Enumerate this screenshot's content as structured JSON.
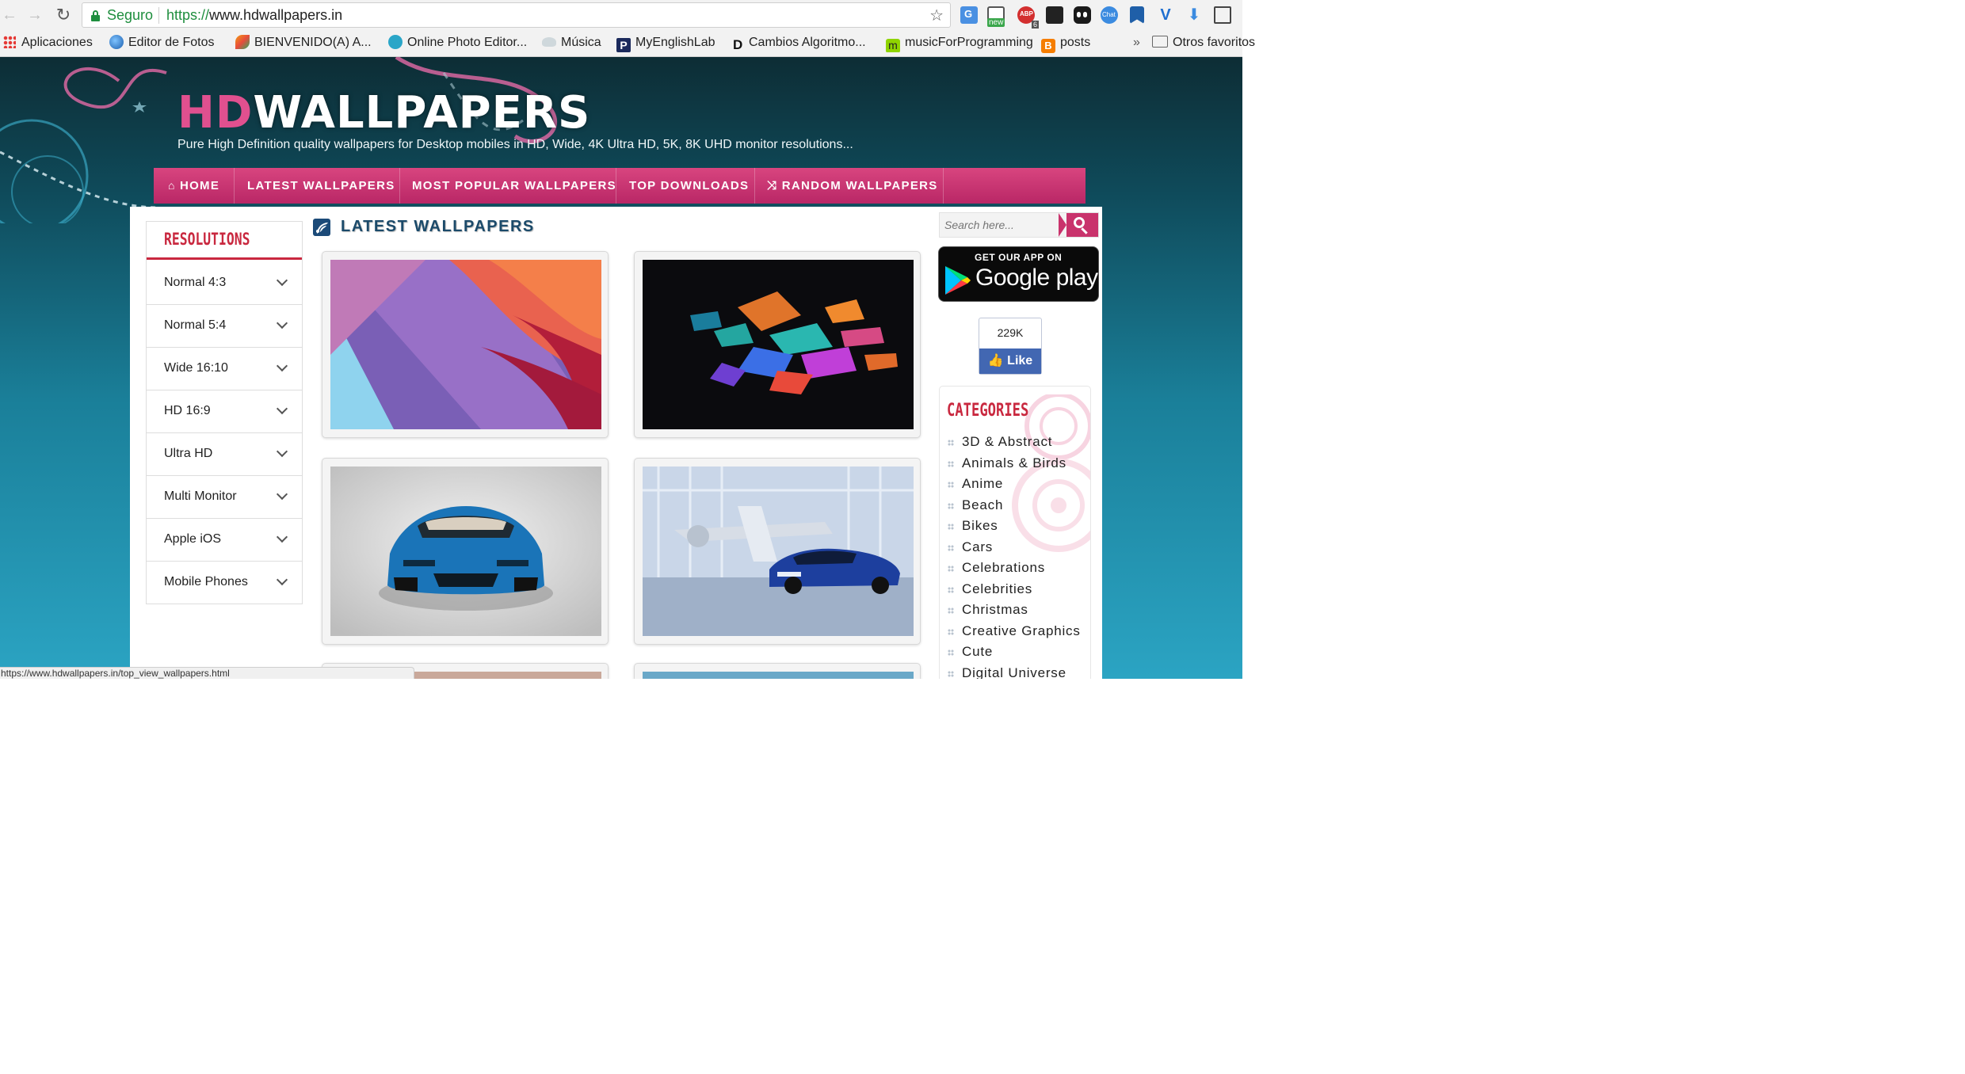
{
  "browser": {
    "secure_label": "Seguro",
    "url_scheme": "https://",
    "url_host": "www.hdwallpapers.in",
    "extensions": [
      "translate-icon",
      "new-icon",
      "adblock-icon",
      "clapper-icon",
      "eyes-icon",
      "chat-icon",
      "bookmark-icon",
      "vector-icon",
      "download-icon",
      "screen-icon"
    ],
    "extension_badges": {
      "new": "new",
      "adblock": "6",
      "chat": "Chat"
    }
  },
  "bookmarks": {
    "items": [
      {
        "label": "Aplicaciones",
        "icon": "apps-grid-icon"
      },
      {
        "label": "Editor de Fotos",
        "icon": "globe-icon"
      },
      {
        "label": "BIENVENIDO(A) A...",
        "icon": "leaf-icon"
      },
      {
        "label": "Online Photo Editor...",
        "icon": "swirl-icon"
      },
      {
        "label": "Música",
        "icon": "cloud-icon"
      },
      {
        "label": "MyEnglishLab",
        "icon": "p-icon"
      },
      {
        "label": "Cambios Algoritmo...",
        "icon": "d-icon"
      },
      {
        "label": "musicForProgramming",
        "icon": "m-icon"
      },
      {
        "label": "posts",
        "icon": "blogger-icon"
      }
    ],
    "overflow": "»",
    "other": "Otros favoritos"
  },
  "site": {
    "logo_hd": "HD",
    "logo_wallpapers": "WALLPAPERS",
    "tagline": "Pure High Definition quality wallpapers for Desktop mobiles in HD, Wide, 4K Ultra HD, 5K, 8K UHD monitor resolutions...",
    "nav": [
      "HOME",
      "LATEST WALLPAPERS",
      "MOST POPULAR WALLPAPERS",
      "TOP DOWNLOADS",
      "RANDOM WALLPAPERS"
    ],
    "accent": "#c9336c"
  },
  "sidebar": {
    "title": "RESOLUTIONS",
    "items": [
      "Normal 4:3",
      "Normal 5:4",
      "Wide 16:10",
      "HD 16:9",
      "Ultra HD",
      "Multi Monitor",
      "Apple iOS",
      "Mobile Phones"
    ]
  },
  "main": {
    "title": "LATEST WALLPAPERS",
    "thumbnails": [
      "abstract-paper-wallpaper",
      "colorful-shards-wallpaper",
      "blue-lamborghini-wallpaper",
      "bentley-hangar-wallpaper"
    ]
  },
  "right": {
    "search_placeholder": "Search here...",
    "play_small": "GET OUR APP ON",
    "play_big": "Google play",
    "fb_count": "229K",
    "fb_like": "Like",
    "categories_title": "CATEGORIES",
    "categories": [
      "3D & Abstract",
      "Animals & Birds",
      "Anime",
      "Beach",
      "Bikes",
      "Cars",
      "Celebrations",
      "Celebrities",
      "Christmas",
      "Creative Graphics",
      "Cute",
      "Digital Universe"
    ]
  },
  "status": {
    "url": "https://www.hdwallpapers.in/top_view_wallpapers.html"
  }
}
